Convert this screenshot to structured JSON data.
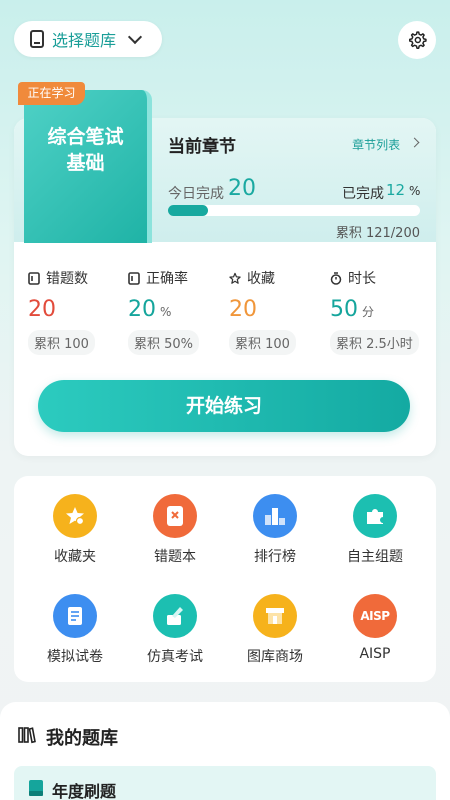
{
  "topbar": {
    "select_bank_label": "选择题库"
  },
  "current": {
    "studying_tag": "正在学习",
    "book_title_line1": "综合笔试",
    "book_title_line2": "基础",
    "chapter_title": "当前章节",
    "chapter_list_label": "章节列表",
    "today_label": "今日完成",
    "today_value": "20",
    "completed_label": "已完成",
    "completed_value": "12",
    "completed_unit": "%",
    "progress_percent": 12,
    "cumulative_label": "累积 121/200"
  },
  "stats": [
    {
      "label": "错题数",
      "value": "20",
      "unit": "",
      "cumulative": "累积 100"
    },
    {
      "label": "正确率",
      "value": "20",
      "unit": "%",
      "cumulative": "累积 50%"
    },
    {
      "label": "收藏",
      "value": "20",
      "unit": "",
      "cumulative": "累积 100"
    },
    {
      "label": "时长",
      "value": "50",
      "unit": "分",
      "cumulative": "累积 2.5小时"
    }
  ],
  "start_button": "开始练习",
  "features": [
    {
      "label": "收藏夹",
      "icon": "star-icon",
      "color": "#f6b21c"
    },
    {
      "label": "错题本",
      "icon": "wrong-book-icon",
      "color": "#f06a3a"
    },
    {
      "label": "排行榜",
      "icon": "ranking-icon",
      "color": "#3d8ef0"
    },
    {
      "label": "自主组题",
      "icon": "puzzle-icon",
      "color": "#1cbfb1"
    },
    {
      "label": "模拟试卷",
      "icon": "paper-icon",
      "color": "#3d8ef0"
    },
    {
      "label": "仿真考试",
      "icon": "exam-icon",
      "color": "#1cbfb1"
    },
    {
      "label": "图库商场",
      "icon": "store-icon",
      "color": "#f6b21c"
    },
    {
      "label": "AISP",
      "icon": "aisp-logo-icon",
      "color": "#f06a3a"
    }
  ],
  "my_bank": {
    "title": "我的题库",
    "first_row": "年度刷题"
  }
}
